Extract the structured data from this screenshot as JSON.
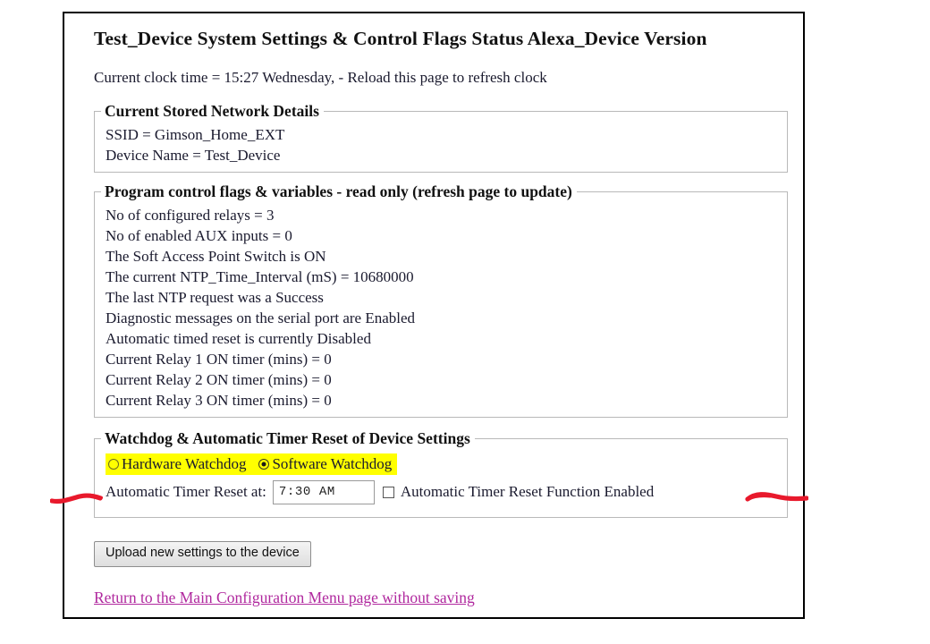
{
  "page": {
    "title": "Test_Device System Settings & Control Flags Status Alexa_Device Version",
    "clock_line": "Current clock time = 15:27 Wednesday, - Reload this page to refresh clock"
  },
  "network_fieldset": {
    "legend": "Current Stored Network Details",
    "lines": [
      "SSID = Gimson_Home_EXT",
      "Device Name = Test_Device"
    ]
  },
  "flags_fieldset": {
    "legend": "Program control flags & variables - read only (refresh page to update)",
    "lines": [
      "No of configured relays = 3",
      "No of enabled AUX inputs = 0",
      "The Soft Access Point Switch is ON",
      "The current NTP_Time_Interval (mS) = 10680000",
      "The last NTP request was a Success",
      "Diagnostic messages on the serial port are Enabled",
      "Automatic timed reset is currently Disabled",
      "Current Relay 1 ON timer (mins) = 0",
      "Current Relay 2 ON timer (mins) = 0",
      "Current Relay 3 ON timer (mins) = 0"
    ]
  },
  "watchdog_fieldset": {
    "legend": "Watchdog & Automatic Timer Reset of Device Settings",
    "hardware_label": "Hardware Watchdog",
    "software_label": "Software Watchdog",
    "hardware_selected": false,
    "software_selected": true,
    "timer_reset_label": "Automatic Timer Reset at:",
    "timer_value": "7:30 AM",
    "timer_placeholder": "7:30 AM",
    "enable_checkbox_label": "Automatic Timer Reset Function Enabled",
    "enable_checkbox_checked": false
  },
  "actions": {
    "submit_label": "Upload new settings to the device",
    "return_link_label": "Return to the Main Configuration Menu page without saving"
  },
  "annotations": {
    "left_arrow": "red-arrow-pointing-right",
    "right_arrow": "red-arrow-pointing-left"
  },
  "colors": {
    "highlight": "#ffff00",
    "link": "#b0289e",
    "annotation": "#e8192c",
    "fieldset_border": "#b9b9b9",
    "page_border": "#000000"
  }
}
